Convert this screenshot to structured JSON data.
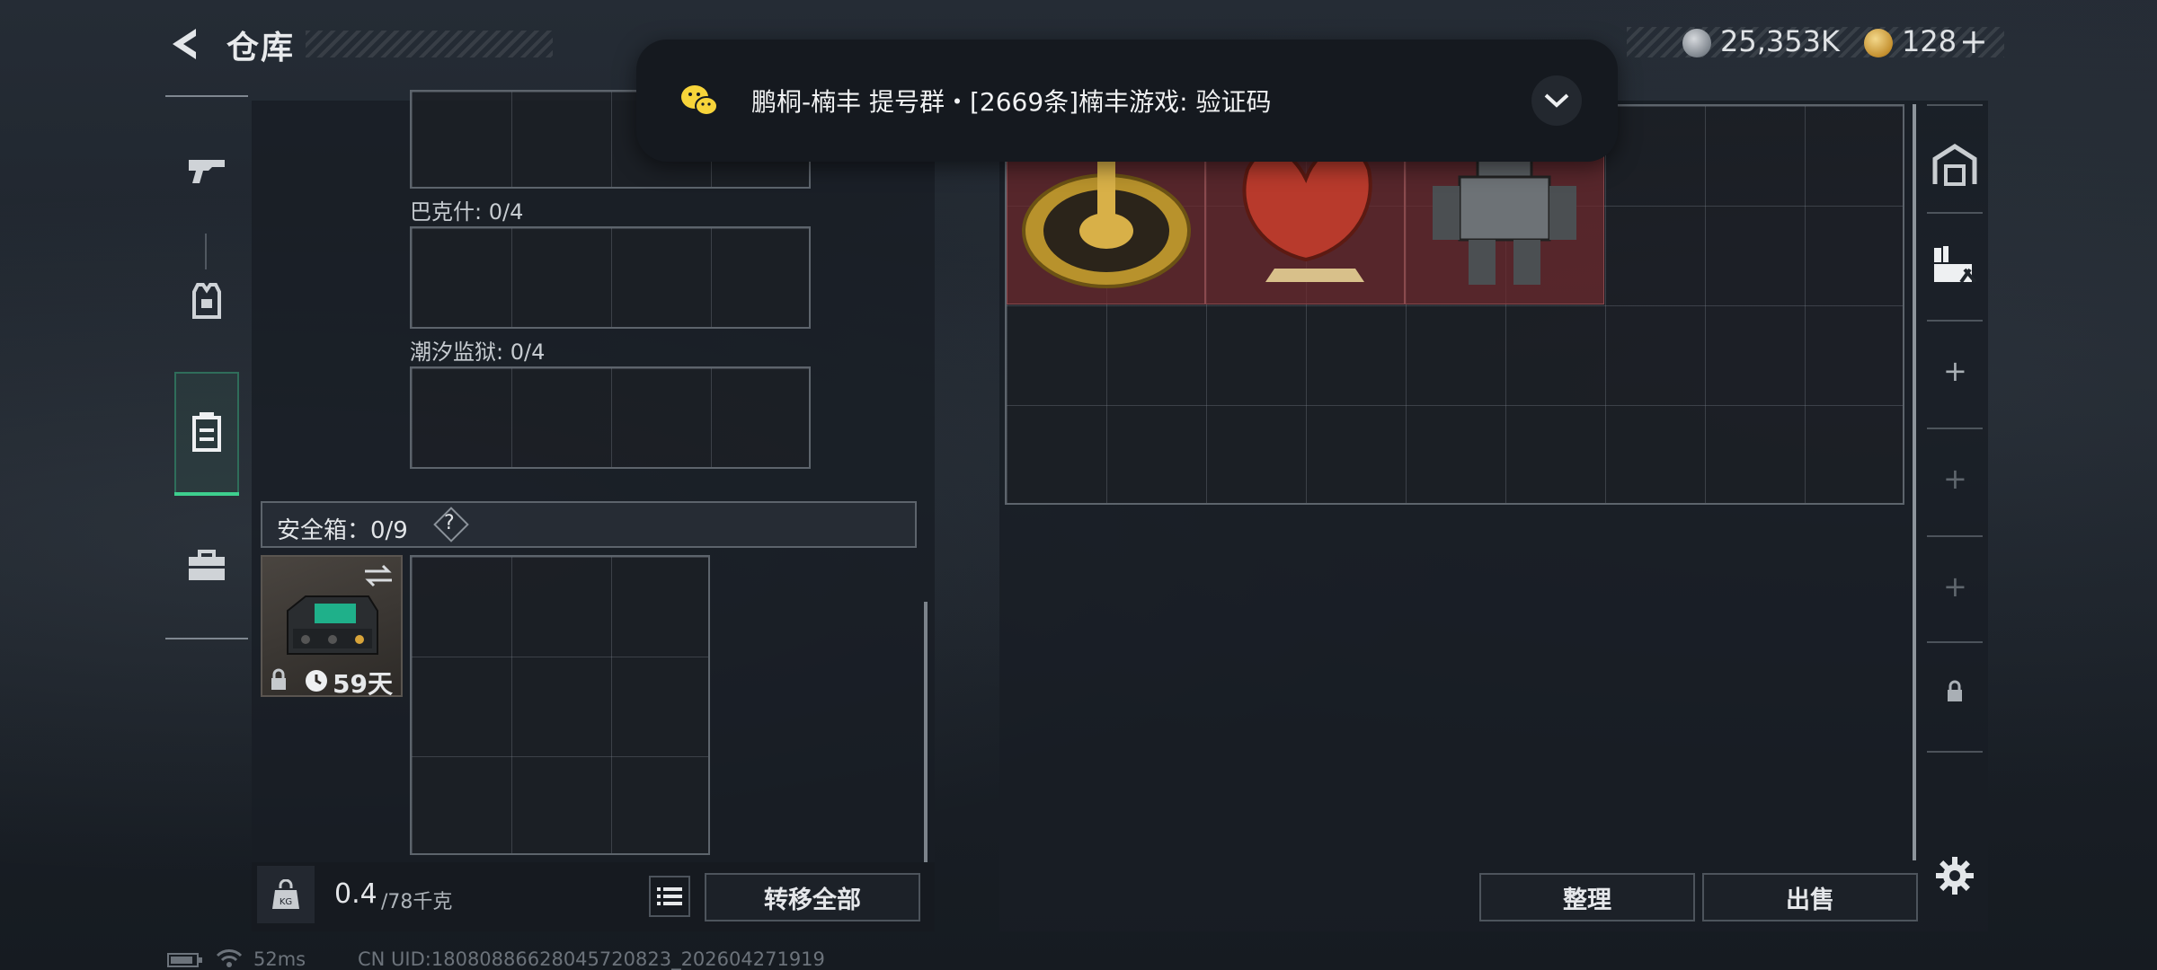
{
  "header": {
    "title": "仓库",
    "currency_silver": "25,353K",
    "currency_gold": "128",
    "add_symbol": "+"
  },
  "notification": {
    "text": "鹏桐-楠丰 提号群・[2669条]楠丰游戏: 验证码"
  },
  "left_panel": {
    "containers": [
      {
        "label": "巴克什: 0/4"
      },
      {
        "label": "潮汐监狱: 0/4"
      }
    ],
    "safe_box": {
      "label": "安全箱：0/9",
      "help": "?",
      "duration": "59天"
    },
    "weight": {
      "current": "0.4",
      "capacity": "/78千克"
    },
    "transfer_all_label": "转移全部"
  },
  "right_panel": {
    "sort_label": "整理",
    "sell_label": "出售"
  },
  "right_sidebar": {
    "add_symbol": "+"
  },
  "status_bar": {
    "ping": "52ms",
    "uid": "CN UID:18080886628045720823_202604271919"
  },
  "colors": {
    "accent_green": "#3ecf8e",
    "item_highlight": "#6b2a2e"
  }
}
